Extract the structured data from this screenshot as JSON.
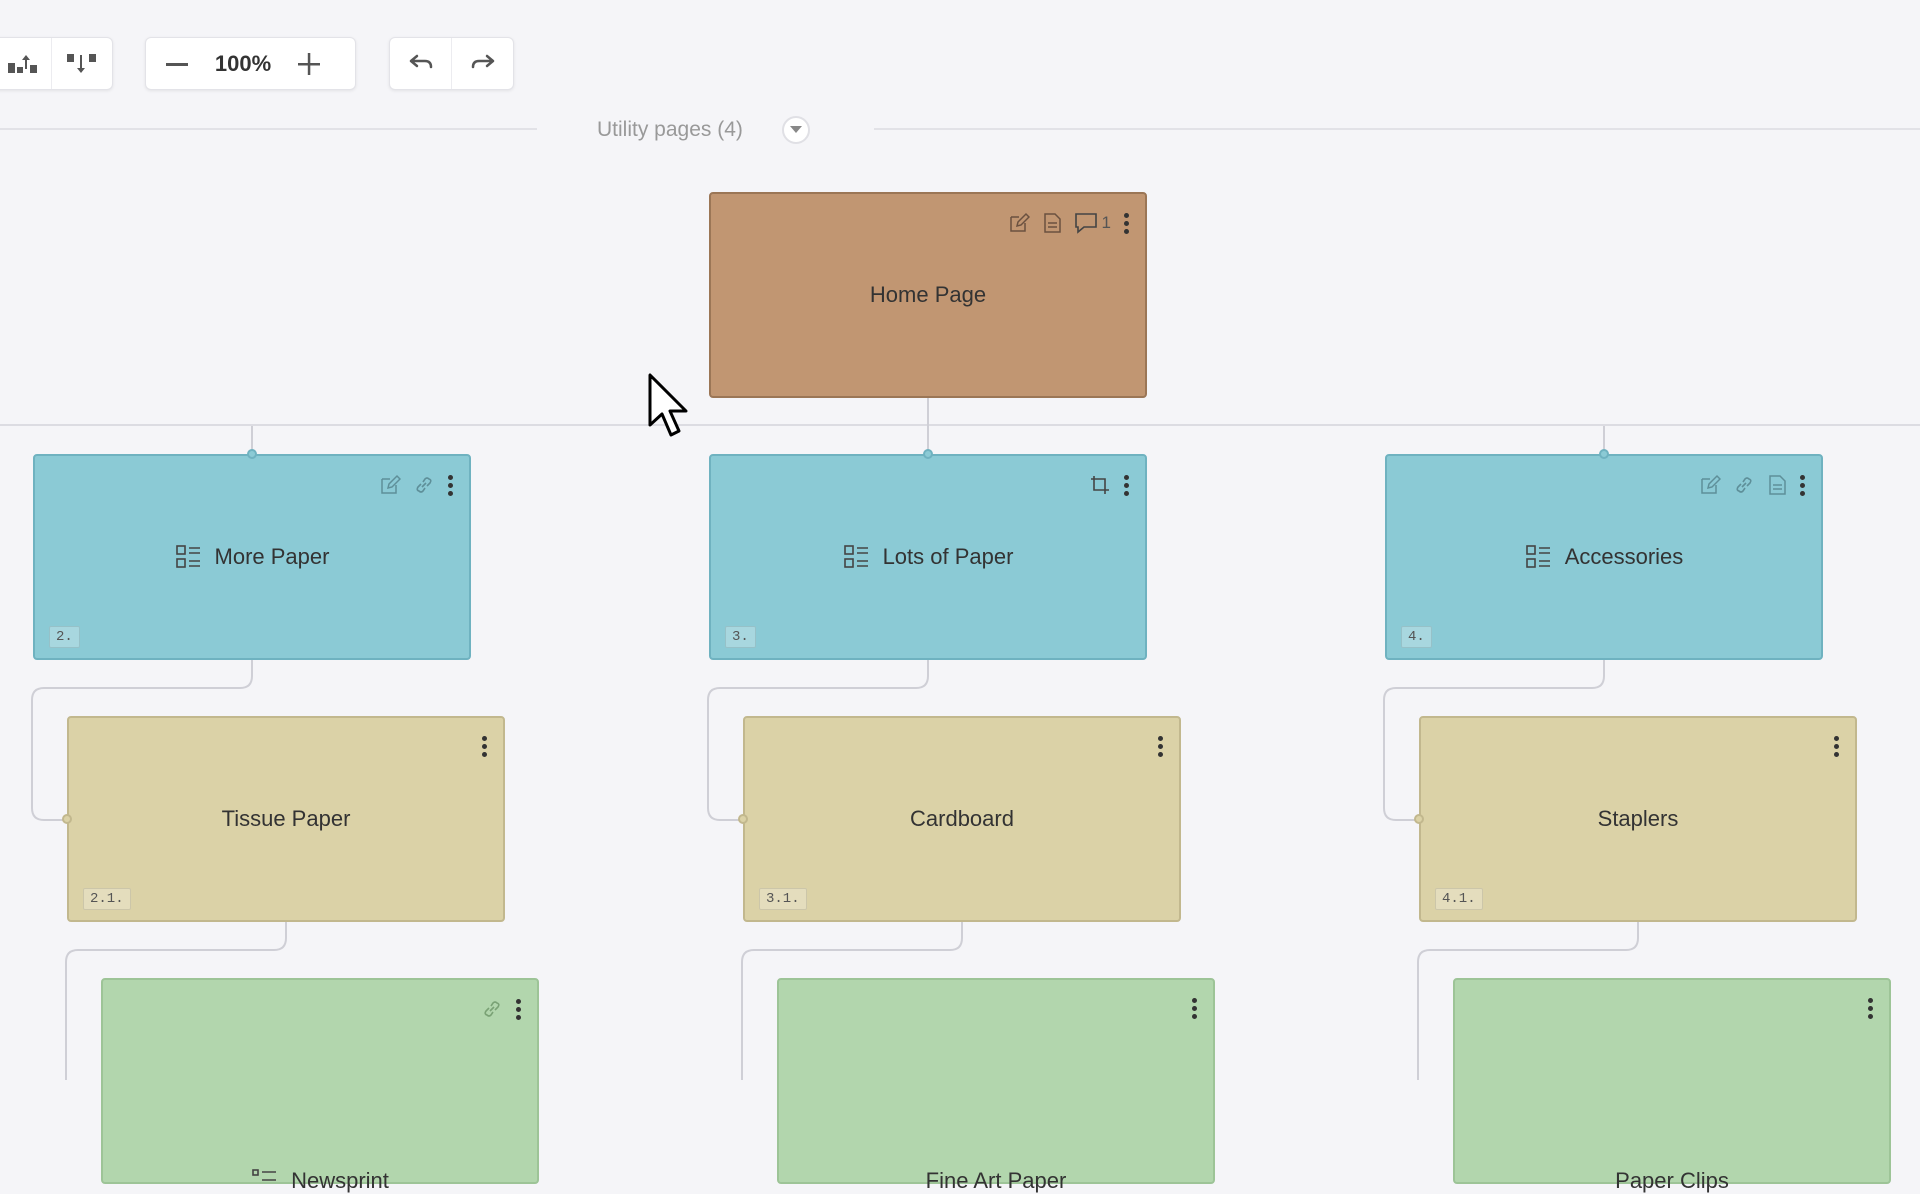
{
  "toolbar": {
    "zoom": "100%",
    "icons": [
      "layout-up-icon",
      "layout-down-icon",
      "zoom-out-icon",
      "zoom-in-icon",
      "undo-icon",
      "redo-icon"
    ]
  },
  "utility": {
    "label": "Utility pages (4)"
  },
  "home": {
    "title": "Home Page",
    "comment_count": "1"
  },
  "sections": [
    {
      "title": "More Paper",
      "number": "2.",
      "child": {
        "title": "Tissue Paper",
        "number": "2.1."
      },
      "grandchild": {
        "title": "Newsprint"
      }
    },
    {
      "title": "Lots of Paper",
      "number": "3.",
      "child": {
        "title": "Cardboard",
        "number": "3.1."
      },
      "grandchild": {
        "title": "Fine Art Paper"
      }
    },
    {
      "title": "Accessories",
      "number": "4.",
      "child": {
        "title": "Staplers",
        "number": "4.1."
      },
      "grandchild": {
        "title": "Paper Clips"
      }
    }
  ],
  "colors": {
    "home": "#c19672",
    "section": "#8bcad5",
    "subsection": "#dbd2a7",
    "leaf": "#b2d6ad",
    "canvas": "#f5f5f8"
  }
}
